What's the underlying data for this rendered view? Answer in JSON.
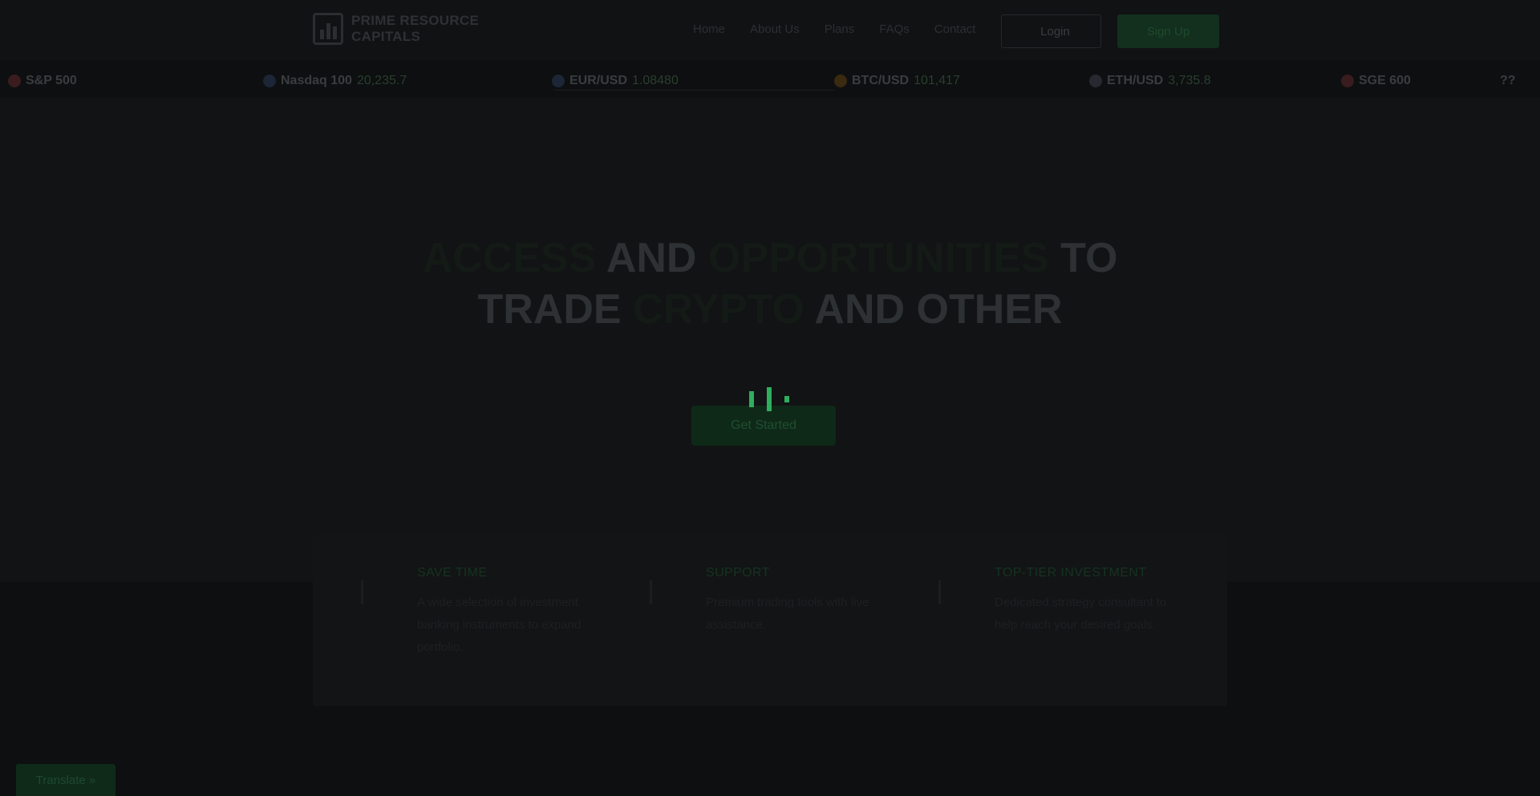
{
  "brand": {
    "line1": "PRIME RESOURCE",
    "line2": "CAPITALS"
  },
  "nav": {
    "links": [
      "Home",
      "About Us",
      "Plans",
      "FAQs",
      "Contact"
    ],
    "login_label": "Login",
    "signup_label": "Sign Up"
  },
  "ticker": [
    {
      "symbol": "S&P 500",
      "value": "",
      "change": ""
    },
    {
      "symbol": "Nasdaq 100",
      "value": "20,235.7",
      "change": ""
    },
    {
      "symbol": "EUR/USD",
      "value": "1.08480",
      "change": ""
    },
    {
      "symbol": "BTC/USD",
      "value": "101,417",
      "change": ""
    },
    {
      "symbol": "ETH/USD",
      "value": "3,735.8",
      "change": ""
    },
    {
      "symbol": "SGE 600",
      "value": "",
      "change": ""
    },
    {
      "symbol": "??",
      "value": "",
      "change": ""
    }
  ],
  "hero": {
    "title_word1": "ACCESS",
    "title_word2": "AND",
    "title_word3": "OPPORTUNITIES",
    "title_word4": "TO",
    "title_word5": "TRADE",
    "title_word6": "CRYPTO",
    "title_word7": "AND OTHER",
    "subtitle": "",
    "cta_label": "Get Started"
  },
  "features": [
    {
      "title": "SAVE TIME",
      "desc": "A wide selection of investment banking instruments to expand portfolio."
    },
    {
      "title": "SUPPORT",
      "desc": "Premium trading tools with live assistance."
    },
    {
      "title": "TOP-TIER INVESTMENT",
      "desc": "Dedicated strategy consultant to help reach your desired goals."
    }
  ],
  "translate": {
    "label": "Translate »"
  },
  "colors": {
    "accent": "#2fae5e",
    "background": "#0d0f10"
  }
}
